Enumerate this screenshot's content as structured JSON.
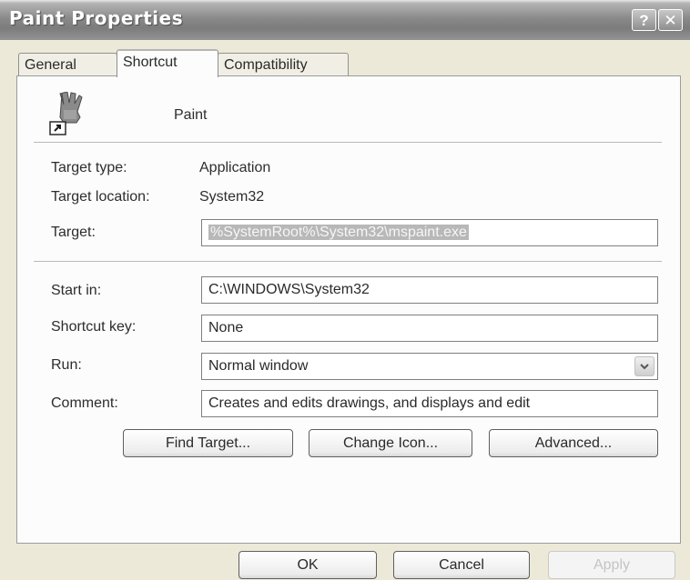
{
  "window": {
    "title": "Paint Properties",
    "help_button": "?",
    "close_button": "✕"
  },
  "tabs": [
    {
      "label": "General",
      "active": false
    },
    {
      "label": "Shortcut",
      "active": true
    },
    {
      "label": "Compatibility",
      "active": false
    }
  ],
  "shortcut": {
    "app_name": "Paint",
    "app_icon": "paint-brush-icon",
    "target_type_label": "Target type:",
    "target_type_value": "Application",
    "target_location_label": "Target location:",
    "target_location_value": "System32",
    "target_label": "Target:",
    "target_value": "%SystemRoot%\\System32\\mspaint.exe",
    "start_in_label": "Start in:",
    "start_in_value": "C:\\WINDOWS\\System32",
    "shortcut_key_label": "Shortcut key:",
    "shortcut_key_value": "None",
    "run_label": "Run:",
    "run_value": "Normal window",
    "comment_label": "Comment:",
    "comment_value": "Creates and edits drawings, and displays and edit",
    "find_target_label": "Find Target...",
    "change_icon_label": "Change Icon...",
    "advanced_label": "Advanced..."
  },
  "footer": {
    "ok_label": "OK",
    "cancel_label": "Cancel",
    "apply_label": "Apply"
  }
}
